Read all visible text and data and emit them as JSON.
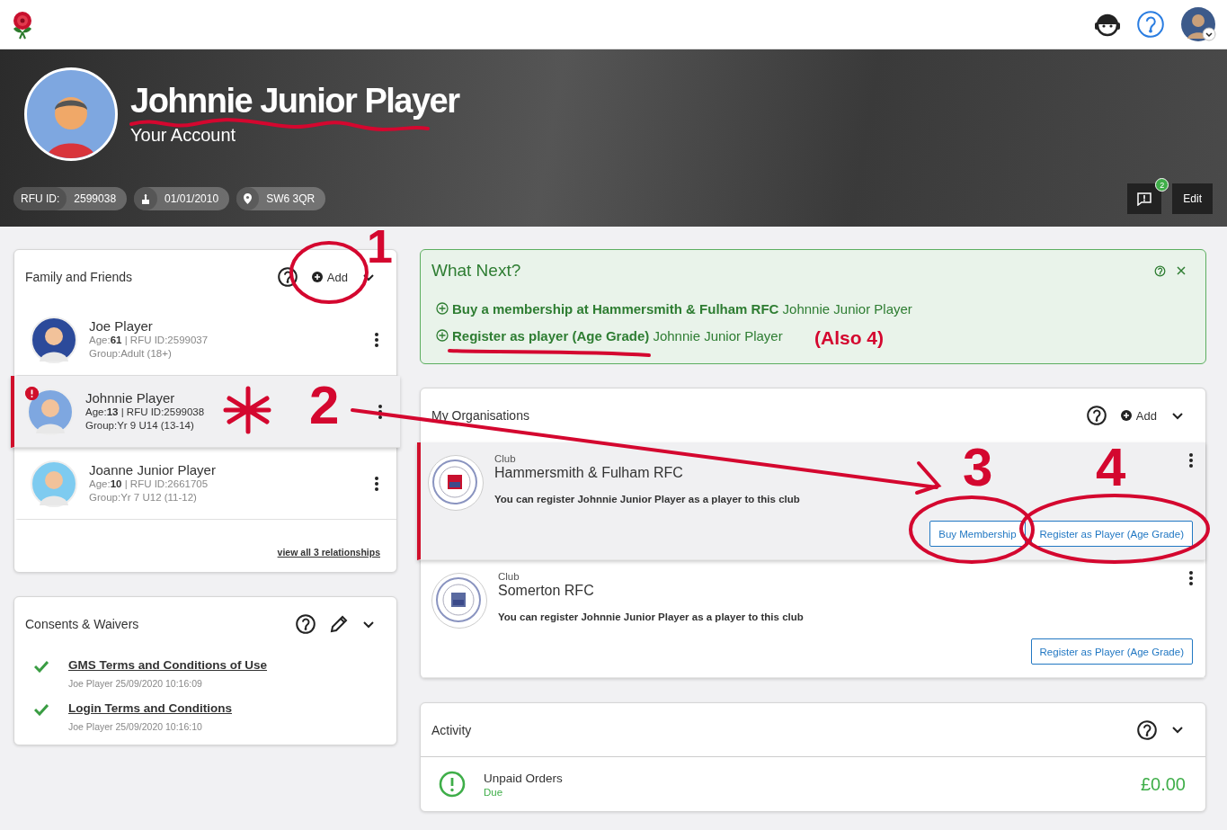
{
  "hero": {
    "name": "Johnnie Junior Player",
    "subtitle": "Your Account",
    "chips": [
      {
        "kind": "id",
        "label": "RFU ID:",
        "value": "2599038"
      },
      {
        "kind": "birthday",
        "value": "01/01/2010"
      },
      {
        "kind": "location",
        "value": "SW6 3QR"
      }
    ],
    "notification_count": "2",
    "edit": "Edit"
  },
  "family": {
    "title": "Family and Friends",
    "add": "Add",
    "members": [
      {
        "name": "Joe Player",
        "details": "Age:**61** | RFU ID:2599037",
        "group": "Group:Adult (18+)",
        "selected": false,
        "alert": false
      },
      {
        "name": "Johnnie Player",
        "details": "Age:**13** | RFU ID:2599038",
        "group": "Group:Yr 9 U14 (13-14)",
        "selected": true,
        "alert": true
      },
      {
        "name": "Joanne Junior Player",
        "details": "Age:**10** | RFU ID:2661705",
        "group": "Group:Yr 7 U12 (11-12)",
        "selected": false,
        "alert": false
      }
    ],
    "link": "view all 3 relationships"
  },
  "consents": {
    "title": "Consents & Waivers",
    "items": [
      {
        "title": "GMS Terms and Conditions of Use",
        "signed": "Joe Player 25/09/2020 10:16:09",
        "checked": true
      },
      {
        "title": "Login Terms and Conditions",
        "signed": "Joe Player 25/09/2020 10:16:10",
        "checked": true
      }
    ]
  },
  "what_next": {
    "title": "What Next?",
    "items": [
      {
        "text": "**Buy a membership at Hammersmith & Fulham RFC** Johnnie Junior Player"
      },
      {
        "text": "**Register as player (Age Grade)** Johnnie Junior Player"
      }
    ]
  },
  "organisations": {
    "title": "My Organisations",
    "add": "Add",
    "items": [
      {
        "type": "Club",
        "name": "Hammersmith & Fulham RFC",
        "note": "You can register Johnnie Junior Player as a player to this club",
        "buttons": [
          "Buy Membership",
          "Register as Player (Age Grade)"
        ],
        "selected": true
      },
      {
        "type": "Club",
        "name": "Somerton RFC",
        "note": "You can register Johnnie Junior Player as a player to this club",
        "buttons": [
          "Register as Player (Age Grade)"
        ],
        "selected": false
      }
    ]
  },
  "activity": {
    "title": "Activity",
    "items": [
      {
        "label": "Unpaid Orders",
        "status": "Due",
        "amount": "£0.00"
      }
    ]
  },
  "annotations": [
    {
      "kind": "number",
      "text": "1"
    },
    {
      "kind": "number",
      "text": "2"
    },
    {
      "kind": "number",
      "text": "3"
    },
    {
      "kind": "number",
      "text": "4"
    },
    {
      "kind": "note",
      "text": "(Also 4)"
    }
  ]
}
